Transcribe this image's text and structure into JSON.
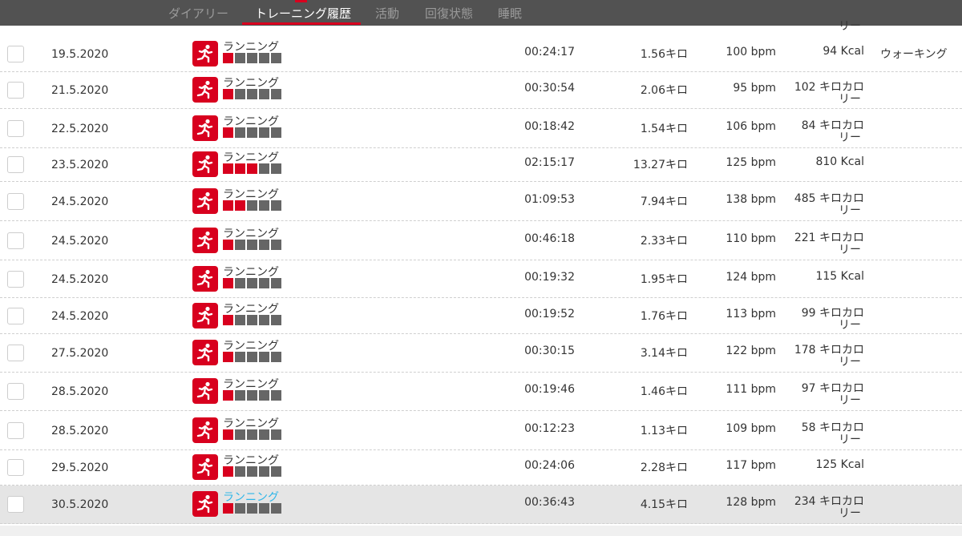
{
  "nav": {
    "tabs": [
      {
        "label": "ダイアリー",
        "active": false
      },
      {
        "label": "トレーニング履歴",
        "active": true
      },
      {
        "label": "活動",
        "active": false
      },
      {
        "label": "回復状態",
        "active": false
      },
      {
        "label": "睡眠",
        "active": false
      }
    ]
  },
  "top_cut_text": "リー",
  "colors": {
    "accent": "#d8001e",
    "bar_empty": "#666666",
    "bar_filled": "#d8001e",
    "link": "#2fb6e8"
  },
  "rows": [
    {
      "date": "19.5.2020",
      "sport": "ランニング",
      "level": 1,
      "time": "00:24:17",
      "distance": "1.56キロ",
      "hr": "100 bpm",
      "cal_line1": "94 Kcal",
      "cal_line2": "",
      "note": "ウォーキング"
    },
    {
      "date": "21.5.2020",
      "sport": "ランニング",
      "level": 1,
      "time": "00:30:54",
      "distance": "2.06キロ",
      "hr": "95 bpm",
      "cal_line1": "102 キロカロ",
      "cal_line2": "リー",
      "note": ""
    },
    {
      "date": "22.5.2020",
      "sport": "ランニング",
      "level": 1,
      "time": "00:18:42",
      "distance": "1.54キロ",
      "hr": "106 bpm",
      "cal_line1": "84 キロカロ",
      "cal_line2": "リー",
      "note": ""
    },
    {
      "date": "23.5.2020",
      "sport": "ランニング",
      "level": 3,
      "time": "02:15:17",
      "distance": "13.27キロ",
      "hr": "125 bpm",
      "cal_line1": "810 Kcal",
      "cal_line2": "",
      "note": ""
    },
    {
      "date": "24.5.2020",
      "sport": "ランニング",
      "level": 2,
      "time": "01:09:53",
      "distance": "7.94キロ",
      "hr": "138 bpm",
      "cal_line1": "485 キロカロ",
      "cal_line2": "リー",
      "note": ""
    },
    {
      "date": "24.5.2020",
      "sport": "ランニング",
      "level": 1,
      "time": "00:46:18",
      "distance": "2.33キロ",
      "hr": "110 bpm",
      "cal_line1": "221 キロカロ",
      "cal_line2": "リー",
      "note": ""
    },
    {
      "date": "24.5.2020",
      "sport": "ランニング",
      "level": 1,
      "time": "00:19:32",
      "distance": "1.95キロ",
      "hr": "124 bpm",
      "cal_line1": "115 Kcal",
      "cal_line2": "",
      "note": ""
    },
    {
      "date": "24.5.2020",
      "sport": "ランニング",
      "level": 1,
      "time": "00:19:52",
      "distance": "1.76キロ",
      "hr": "113 bpm",
      "cal_line1": "99 キロカロ",
      "cal_line2": "リー",
      "note": ""
    },
    {
      "date": "27.5.2020",
      "sport": "ランニング",
      "level": 1,
      "time": "00:30:15",
      "distance": "3.14キロ",
      "hr": "122 bpm",
      "cal_line1": "178 キロカロ",
      "cal_line2": "リー",
      "note": ""
    },
    {
      "date": "28.5.2020",
      "sport": "ランニング",
      "level": 1,
      "time": "00:19:46",
      "distance": "1.46キロ",
      "hr": "111 bpm",
      "cal_line1": "97 キロカロ",
      "cal_line2": "リー",
      "note": ""
    },
    {
      "date": "28.5.2020",
      "sport": "ランニング",
      "level": 1,
      "time": "00:12:23",
      "distance": "1.13キロ",
      "hr": "109 bpm",
      "cal_line1": "58 キロカロ",
      "cal_line2": "リー",
      "note": ""
    },
    {
      "date": "29.5.2020",
      "sport": "ランニング",
      "level": 1,
      "time": "00:24:06",
      "distance": "2.28キロ",
      "hr": "117 bpm",
      "cal_line1": "125 Kcal",
      "cal_line2": "",
      "note": ""
    },
    {
      "date": "30.5.2020",
      "sport": "ランニング",
      "level": 1,
      "time": "00:36:43",
      "distance": "4.15キロ",
      "hr": "128 bpm",
      "cal_line1": "234 キロカロ",
      "cal_line2": "リー",
      "note": "",
      "selected": true,
      "link": true
    }
  ]
}
